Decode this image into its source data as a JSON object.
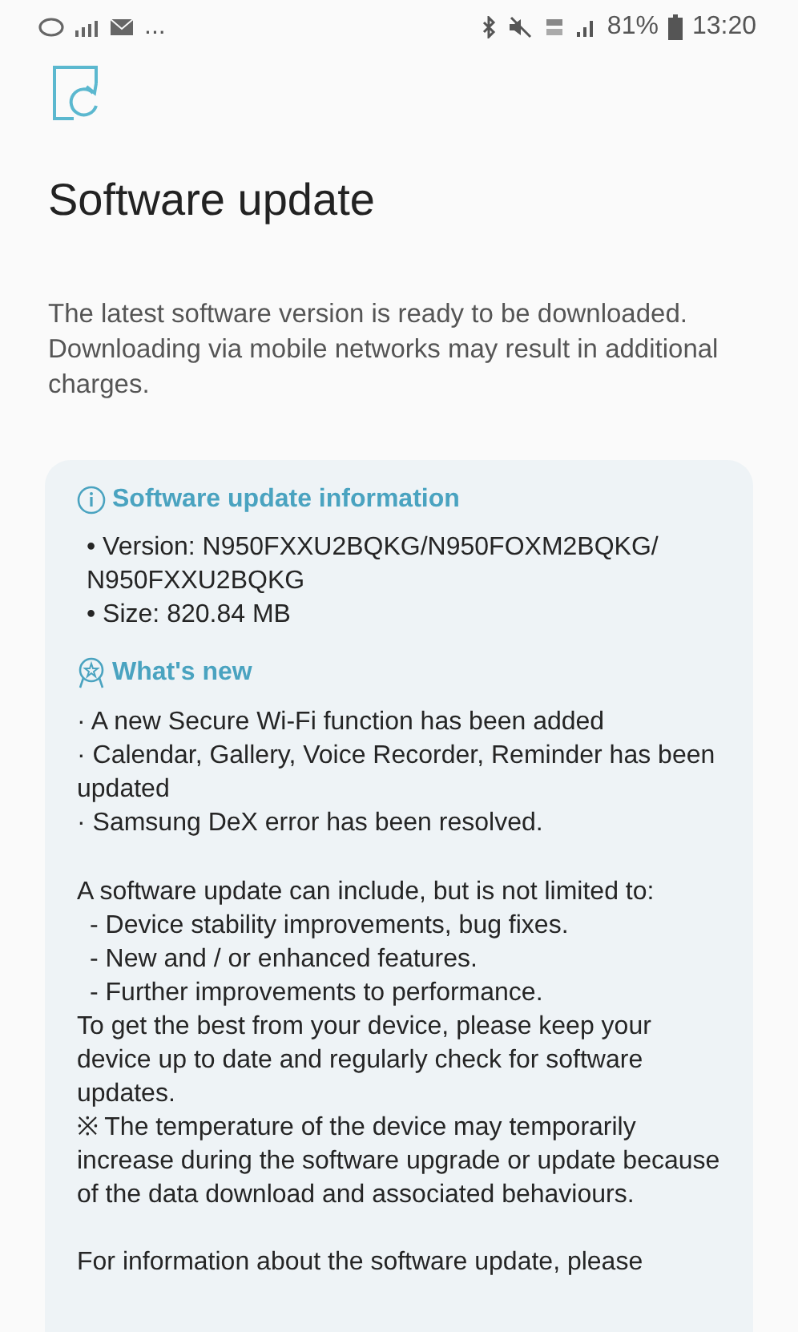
{
  "status_bar": {
    "more": "...",
    "battery": "81%",
    "time": "13:20"
  },
  "title": "Software update",
  "intro": "The latest software version is ready to be downloaded. Downloading via mobile networks may result in additional charges.",
  "info": {
    "heading": "Software update information",
    "items": [
      "• Version: N950FXXU2BQKG/N950FOXM2BQKG/ N950FXXU2BQKG",
      "• Size: 820.84 MB"
    ]
  },
  "whats_new": {
    "heading": "What's new",
    "items": [
      "· A new Secure Wi-Fi function has been added",
      "· Calendar, Gallery, Voice Recorder, Reminder has been updated",
      "· Samsung DeX error has been resolved."
    ]
  },
  "notes": [
    {
      "kind": "text",
      "text": "A software update can include, but is not limited to:"
    },
    {
      "kind": "sub",
      "text": "- Device stability improvements, bug fixes."
    },
    {
      "kind": "sub",
      "text": "- New and / or enhanced features."
    },
    {
      "kind": "sub",
      "text": "- Further improvements to performance."
    },
    {
      "kind": "text",
      "text": "To get the best from your device, please keep your device up to date and regularly check for software updates."
    },
    {
      "kind": "text",
      "text": "※ The temperature of the device may temporarily increase during the software upgrade or update because of the data download and associated behaviours."
    },
    {
      "kind": "gap",
      "text": "For information about the software update, please"
    }
  ]
}
